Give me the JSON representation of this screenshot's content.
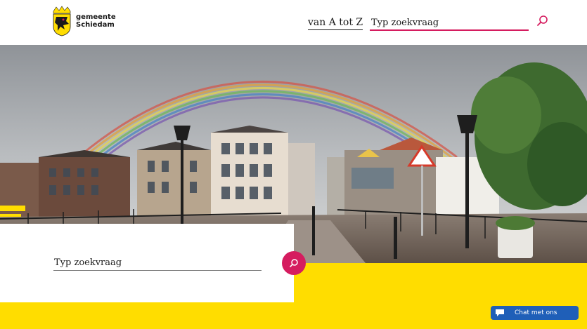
{
  "header": {
    "logo_line1": "gemeente",
    "logo_line2": "Schiedam",
    "nav_link": "van A tot Z",
    "search_placeholder": "Typ zoekvraag",
    "search_icon": "search-icon"
  },
  "hero": {
    "image_icon": "hero-photo"
  },
  "main_search": {
    "placeholder": "Typ zoekvraag",
    "button_icon": "search-icon"
  },
  "chat": {
    "label": "Chat met ons",
    "icon": "speech-bubble-icon"
  },
  "colors": {
    "accent_pink": "#d51c5f",
    "brand_yellow": "#ffdd00",
    "chat_blue": "#1f5fb8"
  }
}
